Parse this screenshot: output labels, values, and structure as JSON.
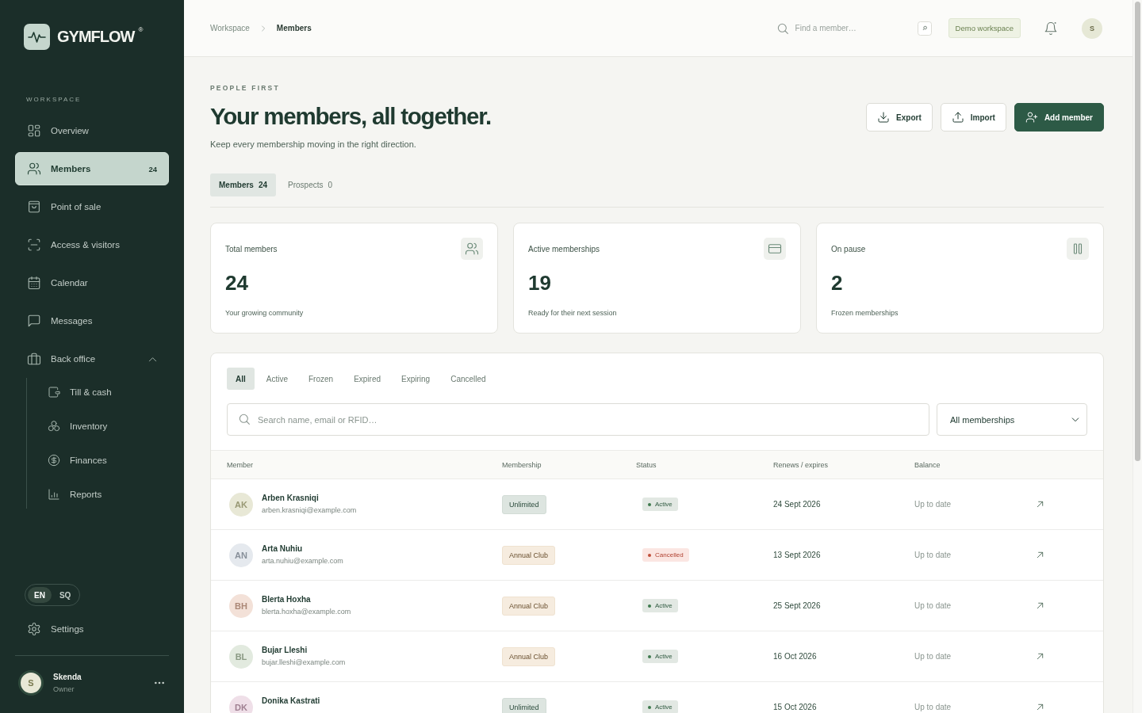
{
  "sidebar": {
    "logo": {
      "name": "GYMFLOW",
      "mark": "®"
    },
    "section_label": "WORKSPACE",
    "items": [
      {
        "label": "Overview",
        "selected": false
      },
      {
        "label": "Members",
        "selected": true,
        "count": "24"
      },
      {
        "label": "Point of sale",
        "selected": false
      },
      {
        "label": "Access & visitors",
        "selected": false
      },
      {
        "label": "Calendar",
        "selected": false
      },
      {
        "label": "Messages",
        "selected": false
      },
      {
        "label": "Back office",
        "selected": false,
        "expanded": true,
        "children": [
          {
            "label": "Till & cash",
            "selected": false
          },
          {
            "label": "Inventory",
            "selected": false
          },
          {
            "label": "Finances",
            "selected": false
          },
          {
            "label": "Reports",
            "selected": false
          }
        ]
      }
    ],
    "languages": [
      {
        "label": "EN",
        "selected": true
      },
      {
        "label": "SQ",
        "selected": false
      }
    ],
    "settings": {
      "label": "Settings"
    },
    "user": {
      "initial": "S",
      "name": "Skenda",
      "role": "Owner"
    }
  },
  "header": {
    "breadcrumb": [
      "Workspace",
      "Members"
    ],
    "search": {
      "placeholder": "Find a member…"
    },
    "workspace_badge": "Demo workspace",
    "notifications": {
      "unread": true
    },
    "user_initial": "S"
  },
  "page": {
    "eyebrow": "PEOPLE FIRST",
    "title": "Your members, all together.",
    "subtitle": "Keep every membership moving in the right direction.",
    "actions": [
      {
        "label": "Export",
        "kind": "secondary"
      },
      {
        "label": "Import",
        "kind": "secondary"
      },
      {
        "label": "Add member",
        "kind": "primary"
      }
    ],
    "view_tabs": [
      {
        "label": "Members",
        "count": "24",
        "selected": true
      },
      {
        "label": "Prospects",
        "count": "0",
        "selected": false
      }
    ],
    "stats": [
      {
        "label": "Total members",
        "value": "24",
        "caption": "Your growing community"
      },
      {
        "label": "Active memberships",
        "value": "19",
        "caption": "Ready for their next session"
      },
      {
        "label": "On pause",
        "value": "2",
        "caption": "Frozen memberships"
      }
    ]
  },
  "members_table": {
    "filters": [
      {
        "label": "All",
        "selected": true
      },
      {
        "label": "Active",
        "selected": false
      },
      {
        "label": "Frozen",
        "selected": false
      },
      {
        "label": "Expired",
        "selected": false
      },
      {
        "label": "Expiring",
        "selected": false
      },
      {
        "label": "Cancelled",
        "selected": false
      }
    ],
    "search": {
      "placeholder": "Search name, email or RFID…"
    },
    "membership_filter": {
      "value": "All memberships"
    },
    "columns": [
      "Member",
      "Membership",
      "Status",
      "Renews / expires",
      "Balance"
    ],
    "rows": [
      {
        "initials": "AK",
        "color": "#e8e8d6",
        "name": "Arben Krasniqi",
        "email": "arben.krasniqi@example.com",
        "membership": {
          "label": "Unlimited",
          "kind": "unlimited"
        },
        "status": {
          "label": "Active",
          "kind": "active"
        },
        "renews": "24 Sept 2026",
        "balance": "Up to date"
      },
      {
        "initials": "AN",
        "color": "#e5e9ee",
        "name": "Arta Nuhiu",
        "email": "arta.nuhiu@example.com",
        "membership": {
          "label": "Annual Club",
          "kind": "annual"
        },
        "status": {
          "label": "Cancelled",
          "kind": "cancelled"
        },
        "renews": "13 Sept 2026",
        "balance": "Up to date"
      },
      {
        "initials": "BH",
        "color": "#f3e1d8",
        "name": "Blerta Hoxha",
        "email": "blerta.hoxha@example.com",
        "membership": {
          "label": "Annual Club",
          "kind": "annual"
        },
        "status": {
          "label": "Active",
          "kind": "active"
        },
        "renews": "25 Sept 2026",
        "balance": "Up to date"
      },
      {
        "initials": "BL",
        "color": "#e2eadf",
        "name": "Bujar Lleshi",
        "email": "bujar.lleshi@example.com",
        "membership": {
          "label": "Annual Club",
          "kind": "annual"
        },
        "status": {
          "label": "Active",
          "kind": "active"
        },
        "renews": "16 Oct 2026",
        "balance": "Up to date"
      },
      {
        "initials": "DK",
        "color": "#efdfe8",
        "name": "Donika Kastrati",
        "membership": {
          "label": "Unlimited",
          "kind": "unlimited"
        },
        "status": {
          "label": "Active",
          "kind": "active"
        },
        "renews": "15 Oct 2026",
        "balance": "Up to date"
      }
    ]
  }
}
